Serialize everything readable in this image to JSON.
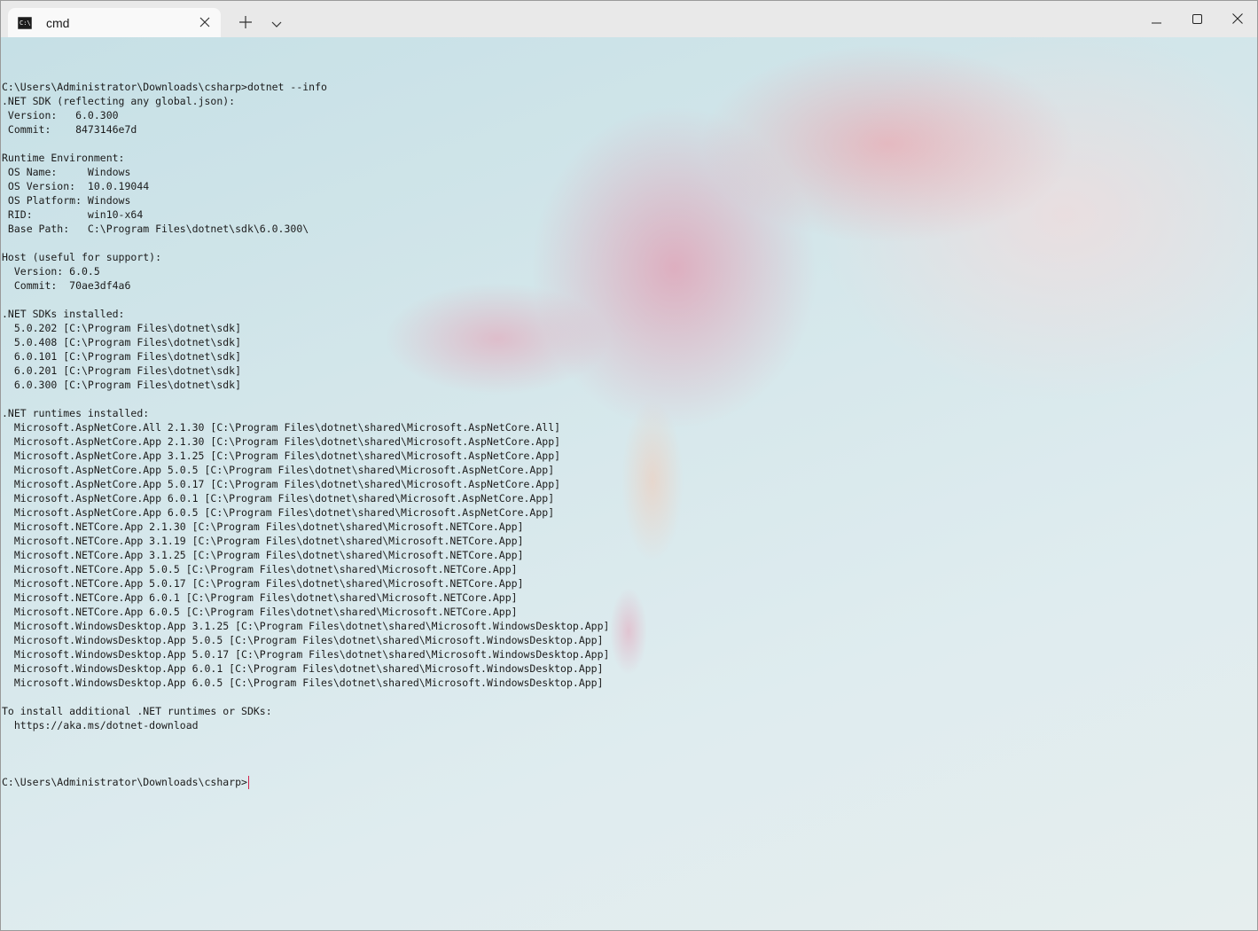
{
  "titlebar": {
    "tab_title": "cmd",
    "tab_icon_glyph": "C:\\",
    "icons": {
      "tab": "terminal-icon",
      "tab_close": "close-icon",
      "new_tab": "plus-icon",
      "dropdown": "chevron-down-icon",
      "minimize": "minimize-icon",
      "maximize": "maximize-icon",
      "close": "close-icon"
    }
  },
  "terminal": {
    "lines": [
      "C:\\Users\\Administrator\\Downloads\\csharp>dotnet --info",
      ".NET SDK (reflecting any global.json):",
      " Version:   6.0.300",
      " Commit:    8473146e7d",
      "",
      "Runtime Environment:",
      " OS Name:     Windows",
      " OS Version:  10.0.19044",
      " OS Platform: Windows",
      " RID:         win10-x64",
      " Base Path:   C:\\Program Files\\dotnet\\sdk\\6.0.300\\",
      "",
      "Host (useful for support):",
      "  Version: 6.0.5",
      "  Commit:  70ae3df4a6",
      "",
      ".NET SDKs installed:",
      "  5.0.202 [C:\\Program Files\\dotnet\\sdk]",
      "  5.0.408 [C:\\Program Files\\dotnet\\sdk]",
      "  6.0.101 [C:\\Program Files\\dotnet\\sdk]",
      "  6.0.201 [C:\\Program Files\\dotnet\\sdk]",
      "  6.0.300 [C:\\Program Files\\dotnet\\sdk]",
      "",
      ".NET runtimes installed:",
      "  Microsoft.AspNetCore.All 2.1.30 [C:\\Program Files\\dotnet\\shared\\Microsoft.AspNetCore.All]",
      "  Microsoft.AspNetCore.App 2.1.30 [C:\\Program Files\\dotnet\\shared\\Microsoft.AspNetCore.App]",
      "  Microsoft.AspNetCore.App 3.1.25 [C:\\Program Files\\dotnet\\shared\\Microsoft.AspNetCore.App]",
      "  Microsoft.AspNetCore.App 5.0.5 [C:\\Program Files\\dotnet\\shared\\Microsoft.AspNetCore.App]",
      "  Microsoft.AspNetCore.App 5.0.17 [C:\\Program Files\\dotnet\\shared\\Microsoft.AspNetCore.App]",
      "  Microsoft.AspNetCore.App 6.0.1 [C:\\Program Files\\dotnet\\shared\\Microsoft.AspNetCore.App]",
      "  Microsoft.AspNetCore.App 6.0.5 [C:\\Program Files\\dotnet\\shared\\Microsoft.AspNetCore.App]",
      "  Microsoft.NETCore.App 2.1.30 [C:\\Program Files\\dotnet\\shared\\Microsoft.NETCore.App]",
      "  Microsoft.NETCore.App 3.1.19 [C:\\Program Files\\dotnet\\shared\\Microsoft.NETCore.App]",
      "  Microsoft.NETCore.App 3.1.25 [C:\\Program Files\\dotnet\\shared\\Microsoft.NETCore.App]",
      "  Microsoft.NETCore.App 5.0.5 [C:\\Program Files\\dotnet\\shared\\Microsoft.NETCore.App]",
      "  Microsoft.NETCore.App 5.0.17 [C:\\Program Files\\dotnet\\shared\\Microsoft.NETCore.App]",
      "  Microsoft.NETCore.App 6.0.1 [C:\\Program Files\\dotnet\\shared\\Microsoft.NETCore.App]",
      "  Microsoft.NETCore.App 6.0.5 [C:\\Program Files\\dotnet\\shared\\Microsoft.NETCore.App]",
      "  Microsoft.WindowsDesktop.App 3.1.25 [C:\\Program Files\\dotnet\\shared\\Microsoft.WindowsDesktop.App]",
      "  Microsoft.WindowsDesktop.App 5.0.5 [C:\\Program Files\\dotnet\\shared\\Microsoft.WindowsDesktop.App]",
      "  Microsoft.WindowsDesktop.App 5.0.17 [C:\\Program Files\\dotnet\\shared\\Microsoft.WindowsDesktop.App]",
      "  Microsoft.WindowsDesktop.App 6.0.1 [C:\\Program Files\\dotnet\\shared\\Microsoft.WindowsDesktop.App]",
      "  Microsoft.WindowsDesktop.App 6.0.5 [C:\\Program Files\\dotnet\\shared\\Microsoft.WindowsDesktop.App]",
      "",
      "To install additional .NET runtimes or SDKs:",
      "  https://aka.ms/dotnet-download",
      ""
    ],
    "prompt": "C:\\Users\\Administrator\\Downloads\\csharp>",
    "cursor_color": "#d0204a",
    "text_color": "#1b1b1b"
  }
}
